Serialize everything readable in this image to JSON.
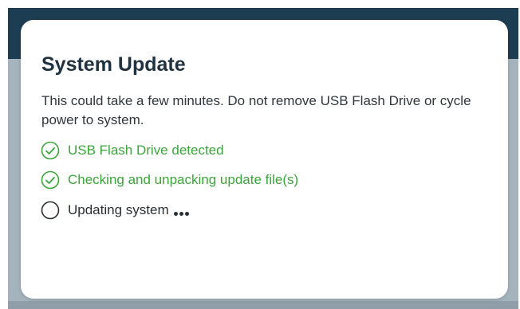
{
  "dialog": {
    "title": "System Update",
    "message": "This could take a few minutes. Do not remove USB Flash Drive or cycle power to system.",
    "steps": [
      {
        "label": "USB Flash Drive detected",
        "status": "done",
        "icon": "check-circle-icon"
      },
      {
        "label": "Checking and unpacking update file(s)",
        "status": "done",
        "icon": "check-circle-icon"
      },
      {
        "label": "Updating system",
        "status": "in-progress",
        "icon": "empty-circle-icon"
      }
    ]
  },
  "colors": {
    "topbar": "#1d3d52",
    "backdrop": "#a4b3bc",
    "success": "#3aa53a",
    "title": "#20323f"
  }
}
